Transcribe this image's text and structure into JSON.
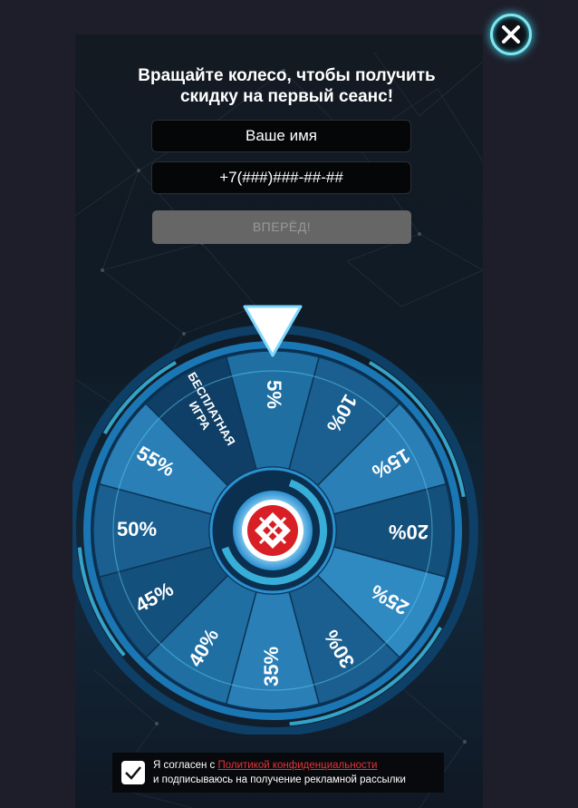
{
  "popup": {
    "title_line1": "Вращайте колесо, чтобы получить",
    "title_line2": "скидку на первый сеанс!",
    "name_placeholder": "Ваше имя",
    "phone_placeholder": "+7(###)###-##-##",
    "submit_label": "ВПЕРЁД!",
    "close_icon": "close-icon"
  },
  "wheel": {
    "segments": [
      "5%",
      "10%",
      "15%",
      "20%",
      "25%",
      "30%",
      "35%",
      "40%",
      "45%",
      "50%",
      "55%",
      "БЕСПЛАТНАЯ ИГРА"
    ],
    "pointer_icon": "triangle-pointer-icon",
    "logo_icon": "brand-logo-icon",
    "colors": {
      "accent": "#3fc4f0",
      "dark": "#0e3f66",
      "mid": "#1a6a9a",
      "logo_red": "#d81f26"
    }
  },
  "consent": {
    "checked": true,
    "prefix": "Я согласен с ",
    "policy_link": "Политикой конфиденциальности",
    "suffix": "и подписываюсь на получение рекламной рассылки"
  }
}
